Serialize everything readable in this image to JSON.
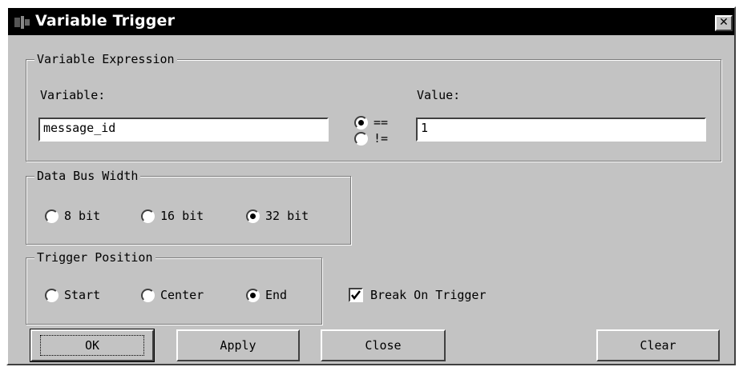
{
  "dialog": {
    "title": "Variable Trigger",
    "close_glyph": "✕"
  },
  "variable_expression": {
    "legend": "Variable Expression",
    "variable_label": "Variable:",
    "variable_value": "message_id",
    "operators": [
      {
        "label": "==",
        "selected": true
      },
      {
        "label": "!=",
        "selected": false
      }
    ],
    "value_label": "Value:",
    "value_value": "1"
  },
  "data_bus_width": {
    "legend": "Data Bus Width",
    "options": [
      {
        "label": "8 bit",
        "selected": false
      },
      {
        "label": "16 bit",
        "selected": false
      },
      {
        "label": "32 bit",
        "selected": true
      }
    ]
  },
  "trigger_position": {
    "legend": "Trigger Position",
    "options": [
      {
        "label": "Start",
        "selected": false
      },
      {
        "label": "Center",
        "selected": false
      },
      {
        "label": "End",
        "selected": true
      }
    ]
  },
  "break_on_trigger": {
    "label": "Break On Trigger",
    "checked": true
  },
  "buttons": {
    "ok": "OK",
    "apply": "Apply",
    "close": "Close",
    "clear": "Clear"
  }
}
